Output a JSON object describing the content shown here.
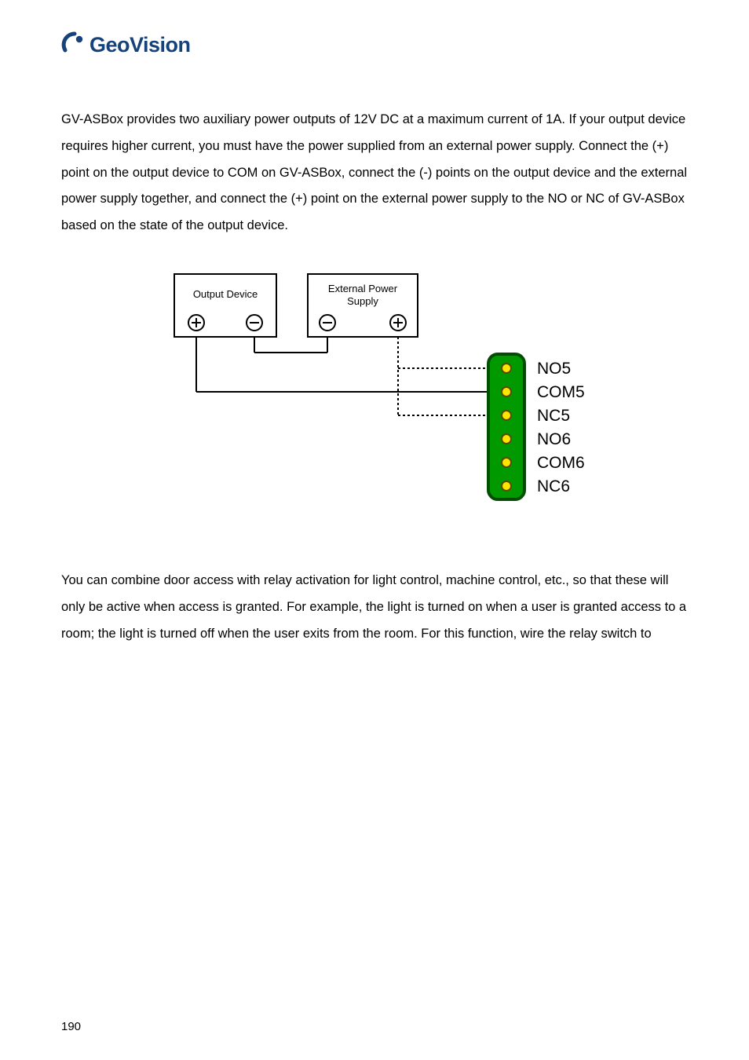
{
  "logo": {
    "text": "GeoVision"
  },
  "paragraphs": {
    "p1": "GV-ASBox provides two auxiliary power outputs of 12V DC at a maximum current of 1A. If your output device requires higher current, you must have the power supplied from an external power supply. Connect the (+) point on the output device to COM on GV-ASBox, connect the (-) points on the output device and the external power supply together, and connect the (+) point on the external power supply to the NO or NC of GV-ASBox based on the state of the output device.",
    "p2": "You can combine door access with relay activation for light control, machine control, etc., so that these will only be active when access is granted. For example, the light is turned on when a user is granted access to a room; the light is turned off when the user exits from the room. For this function, wire the relay switch to"
  },
  "diagram": {
    "output_device_label": "Output Device",
    "external_power_label_line1": "External Power",
    "external_power_label_line2": "Supply",
    "terminals": [
      "NO5",
      "COM5",
      "NC5",
      "NO6",
      "COM6",
      "NC6"
    ]
  },
  "page_number": "190"
}
